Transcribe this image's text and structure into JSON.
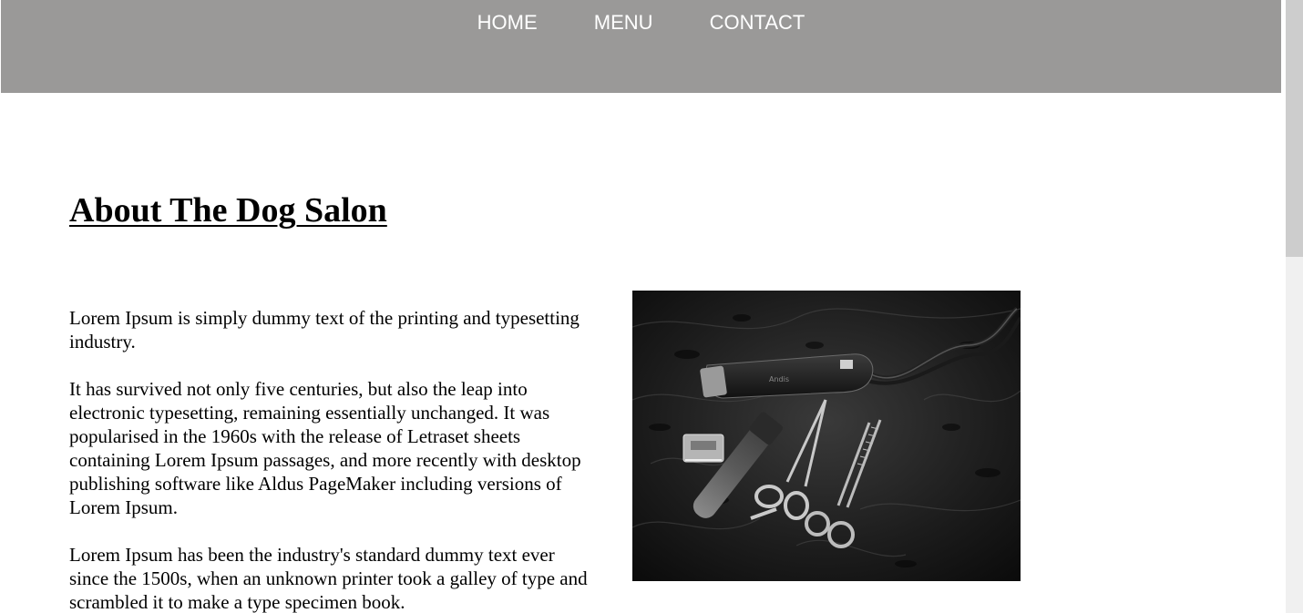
{
  "nav": {
    "items": [
      {
        "label": "HOME"
      },
      {
        "label": "MENU"
      },
      {
        "label": "CONTACT"
      }
    ]
  },
  "main": {
    "title": "About The Dog Salon",
    "paragraphs": [
      "Lorem Ipsum is simply dummy text of the printing and typesetting industry.",
      "It has survived not only five centuries, but also the leap into electronic typesetting, remaining essentially unchanged. It was popularised in the 1960s with the release of Letraset sheets containing Lorem Ipsum passages, and more recently with desktop publishing software like Aldus PageMaker including versions of Lorem Ipsum.",
      "Lorem Ipsum has been the industry's standard dummy text ever since the 1500s, when an unknown printer took a galley of type and scrambled it to make a type specimen book."
    ]
  },
  "colors": {
    "nav_background": "#9a9998",
    "nav_text": "#ffffff",
    "text": "#000000"
  },
  "icons": {
    "image": "dog-grooming-tools-photo"
  }
}
